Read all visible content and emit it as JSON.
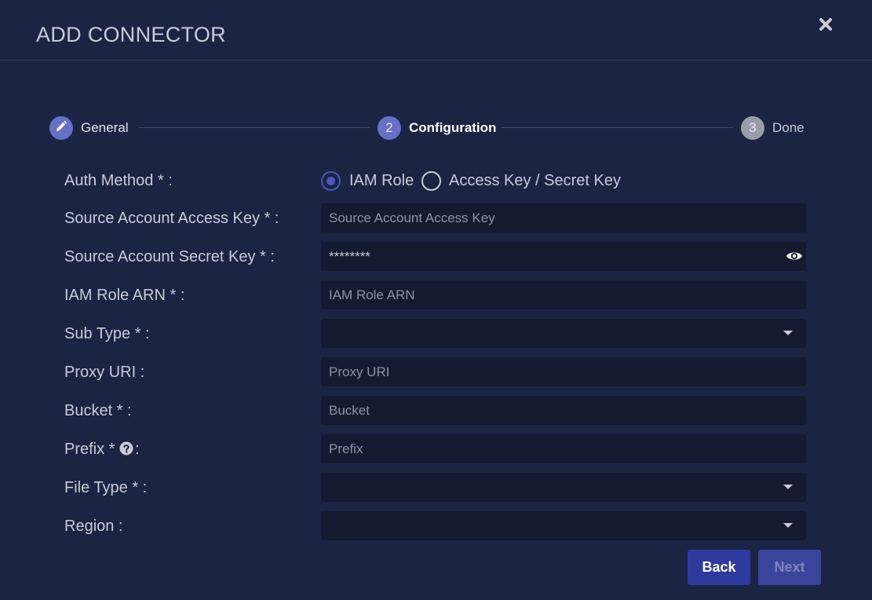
{
  "dialog": {
    "title": "ADD CONNECTOR"
  },
  "stepper": {
    "steps": [
      {
        "number": "",
        "label": "General",
        "state": "completed",
        "icon": "pencil-icon"
      },
      {
        "number": "2",
        "label": "Configuration",
        "state": "active"
      },
      {
        "number": "3",
        "label": "Done",
        "state": "pending"
      }
    ]
  },
  "form": {
    "auth_method": {
      "label": "Auth Method * :",
      "options": [
        "IAM Role",
        "Access Key / Secret Key"
      ],
      "selected": "IAM Role"
    },
    "access_key": {
      "label": "Source Account Access Key * :",
      "placeholder": "Source Account Access Key",
      "value": ""
    },
    "secret_key": {
      "label": "Source Account Secret Key * :",
      "value": "********",
      "icon": "eye-icon"
    },
    "iam_role_arn": {
      "label": "IAM Role ARN * :",
      "placeholder": "IAM Role ARN",
      "value": ""
    },
    "sub_type": {
      "label": "Sub Type * :",
      "value": ""
    },
    "proxy_uri": {
      "label": "Proxy URI  :",
      "placeholder": "Proxy URI",
      "value": ""
    },
    "bucket": {
      "label": "Bucket * :",
      "placeholder": "Bucket",
      "value": ""
    },
    "prefix": {
      "label": "Prefix * ",
      "suffix": ":",
      "placeholder": "Prefix",
      "value": "",
      "icon": "help-icon"
    },
    "file_type": {
      "label": "File Type * :",
      "value": ""
    },
    "region": {
      "label": "Region  :",
      "value": ""
    }
  },
  "buttons": {
    "back": "Back",
    "next": "Next"
  },
  "colors": {
    "background": "#1b2443",
    "field": "#141a30",
    "accent": "#2f3a9e",
    "accent_disabled": "#39449a",
    "step_active": "#6670c4",
    "step_pending": "#9a9ca8"
  }
}
